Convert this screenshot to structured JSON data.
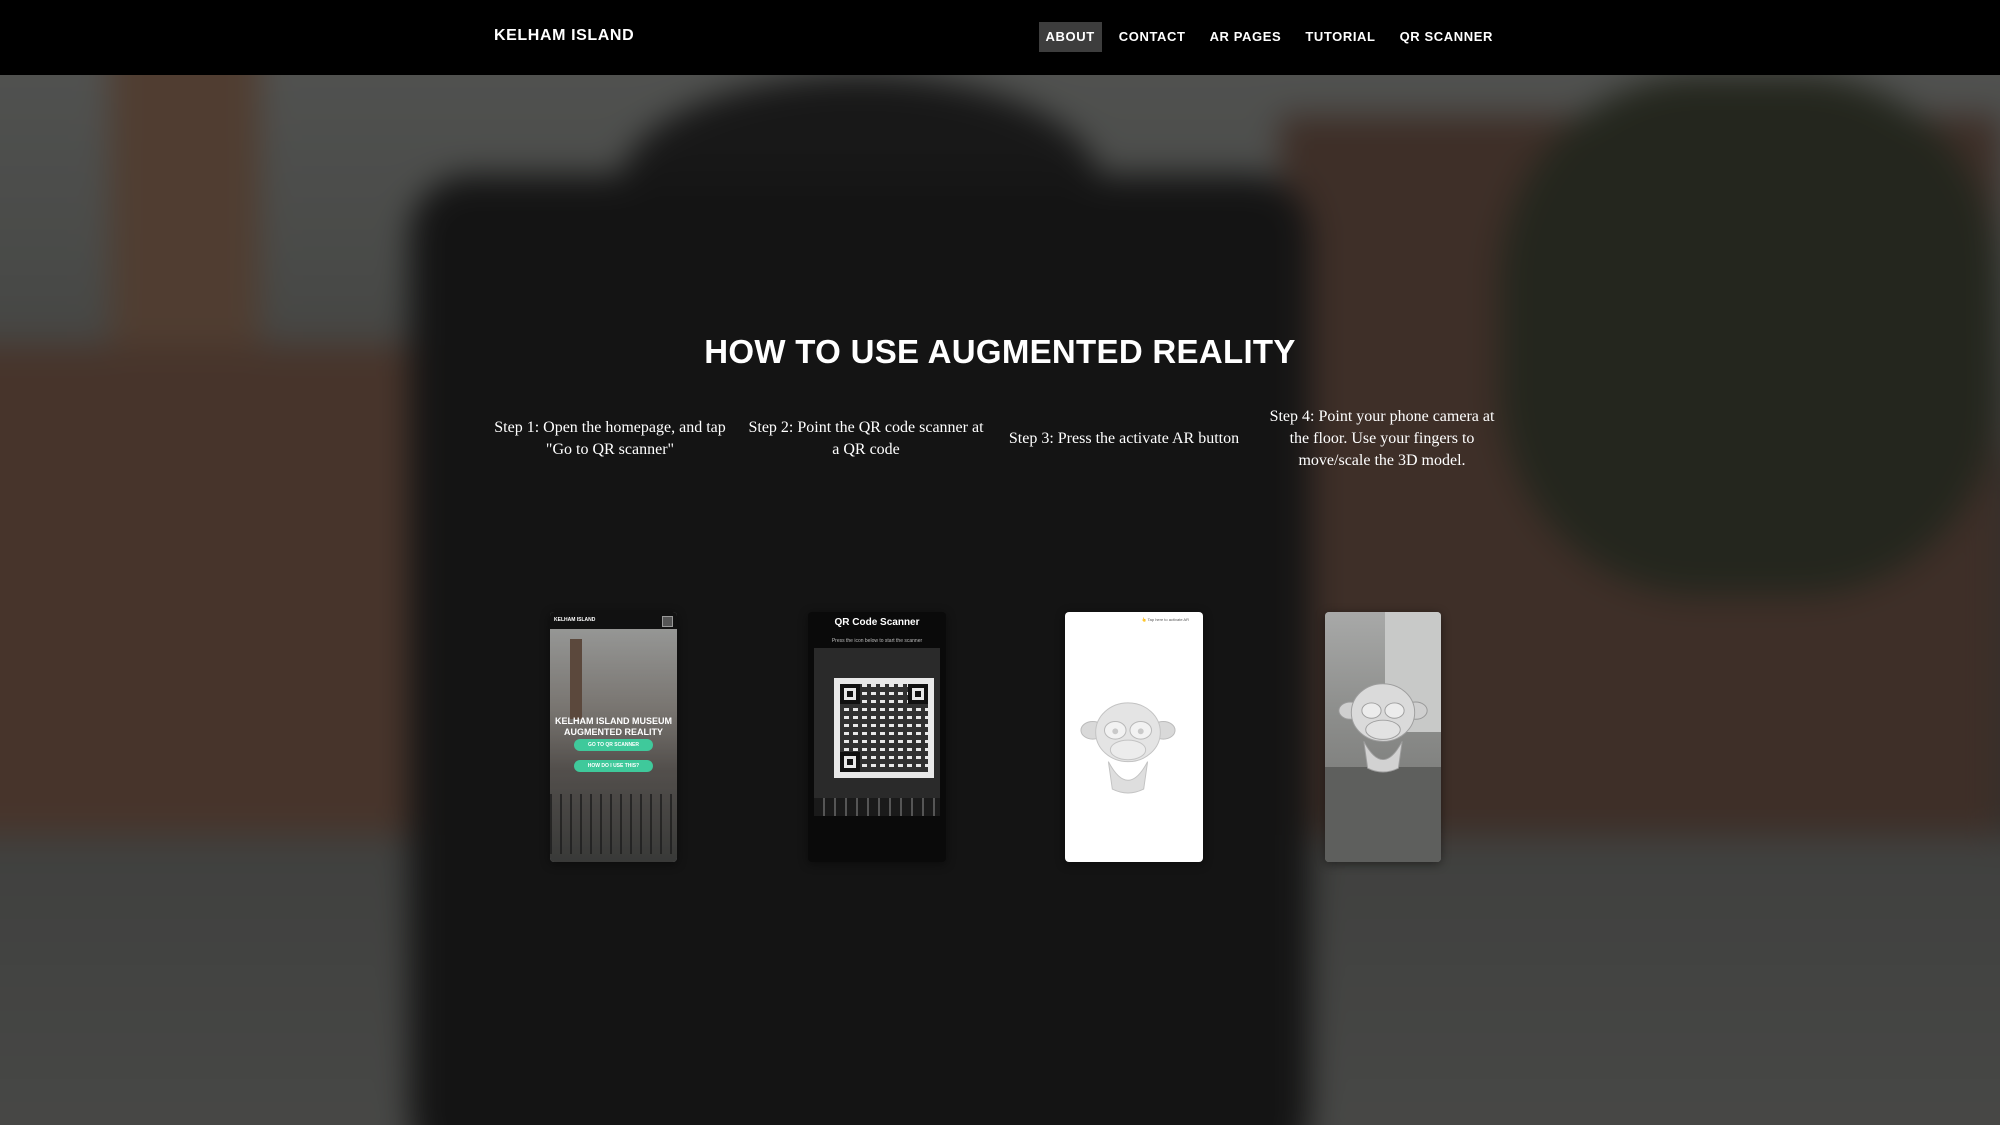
{
  "nav": {
    "brand": "KELHAM ISLAND",
    "items": [
      {
        "label": "ABOUT",
        "active": true
      },
      {
        "label": "CONTACT",
        "active": false
      },
      {
        "label": "AR PAGES",
        "active": false
      },
      {
        "label": "TUTORIAL",
        "active": false
      },
      {
        "label": "QR SCANNER",
        "active": false
      }
    ]
  },
  "main": {
    "title": "HOW TO USE AUGMENTED REALITY",
    "steps": [
      {
        "text": "Step 1: Open the homepage, and tap \"Go to QR scanner\"",
        "phone": {
          "brand": "KELHAM ISLAND",
          "title_line1": "KELHAM ISLAND MUSEUM",
          "title_line2": "AUGMENTED REALITY",
          "button1": "GO TO QR SCANNER",
          "button2": "HOW DO I USE THIS?"
        }
      },
      {
        "text": "Step 2: Point the QR code scanner at a QR code",
        "phone": {
          "title": "QR Code Scanner",
          "subtitle": "Press the icon below to start the scanner"
        }
      },
      {
        "text": "Step 3:  Press the activate AR button",
        "phone": {
          "hint": "👆 Tap here to activate AR"
        }
      },
      {
        "text": "Step 4: Point your phone camera at the floor. Use your fingers to move/scale the 3D model."
      }
    ]
  },
  "colors": {
    "navbar": "#000000",
    "nav_active": "#3d3d3d",
    "accent_button": "#3fc99b",
    "text": "#ffffff"
  }
}
